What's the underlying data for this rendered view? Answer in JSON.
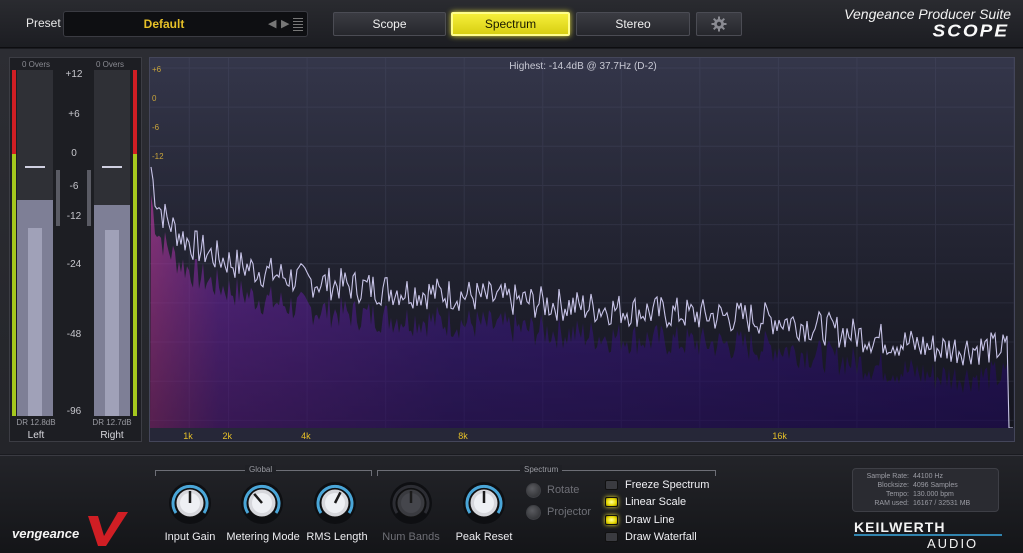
{
  "header": {
    "preset_label": "Preset",
    "preset_name": "Default",
    "preset_prev_icon": "triangle-left-icon",
    "preset_next_icon": "triangle-right-icon",
    "preset_list_icon": "list-icon",
    "tabs": [
      {
        "label": "Scope",
        "active": false
      },
      {
        "label": "Spectrum",
        "active": true
      },
      {
        "label": "Stereo",
        "active": false
      }
    ],
    "settings_icon": "gear-icon",
    "suite_title": "Vengeance Producer Suite",
    "product_logo": "SCOPE"
  },
  "meters": {
    "scale": [
      "+12",
      "+6",
      "0",
      "-6",
      "-12",
      "-24",
      "-48",
      "-96"
    ],
    "channels": [
      {
        "name": "Left",
        "overs": "0 Overs",
        "dr": "DR 12.8dB",
        "level_db": -9.5,
        "rms_db": -16,
        "peak_db": -3
      },
      {
        "name": "Right",
        "overs": "0 Overs",
        "dr": "DR 12.7dB",
        "level_db": -10.5,
        "rms_db": -16.5,
        "peak_db": -3
      }
    ],
    "colors": {
      "red_zone": "#d01e24",
      "green_zone": "#a5c81e"
    }
  },
  "spectrum": {
    "highest_readout": "Highest: -14.4dB @ 37.7Hz (D-2)",
    "db_labels": [
      "+6",
      "0",
      "-6",
      "-12"
    ],
    "freq_labels": [
      "1k",
      "2k",
      "4k",
      "8k",
      "16k"
    ],
    "freq_label_color": "#e6c028",
    "line_color": "#c8c4e8",
    "fill_colors": [
      "#ff4ad8",
      "#3a10a8"
    ],
    "x_scale": "linear",
    "x_range_hz": [
      0,
      22050
    ],
    "chart_data": {
      "type": "area",
      "xlabel": "",
      "ylabel": "",
      "x_ticks": [
        "1k",
        "2k",
        "4k",
        "8k",
        "16k"
      ],
      "y_ticks": [
        "+6",
        "0",
        "-6",
        "-12"
      ],
      "series_description_points": [
        {
          "x": 37.7,
          "y": -14.4
        },
        {
          "x": 500,
          "y": -26
        },
        {
          "x": 2000,
          "y": -34
        },
        {
          "x": 4000,
          "y": -38
        },
        {
          "x": 8000,
          "y": -41
        },
        {
          "x": 12000,
          "y": -44
        },
        {
          "x": 16000,
          "y": -46
        },
        {
          "x": 20000,
          "y": -52
        }
      ]
    }
  },
  "controls": {
    "global_title": "Global",
    "spectrum_title": "Spectrum",
    "knobs": [
      {
        "label": "Input Gain",
        "value": 0.5,
        "enabled": true
      },
      {
        "label": "Metering Mode",
        "value": 0.35,
        "enabled": true
      },
      {
        "label": "RMS Length",
        "value": 0.6,
        "enabled": true
      },
      {
        "label": "Num Bands",
        "value": 0.5,
        "enabled": false
      },
      {
        "label": "Peak Reset",
        "value": 0.5,
        "enabled": true
      }
    ],
    "small_knobs": [
      {
        "label": "Rotate",
        "enabled": false
      },
      {
        "label": "Projector",
        "enabled": false
      }
    ],
    "toggles": [
      {
        "label": "Freeze Spectrum",
        "on": false
      },
      {
        "label": "Linear Scale",
        "on": true
      },
      {
        "label": "Draw Line",
        "on": true
      },
      {
        "label": "Draw Waterfall",
        "on": false
      }
    ],
    "brand_logo": "vengeance",
    "brand_logo_icon": "vengeance-v-logo-icon"
  },
  "info": {
    "rows": [
      {
        "key": "Sample Rate:",
        "value": "44100 Hz"
      },
      {
        "key": "Blocksize:",
        "value": "4096 Samples"
      },
      {
        "key": "Tempo:",
        "value": "130.000 bpm"
      },
      {
        "key": "RAM used:",
        "value": "16167 / 32531 MB"
      }
    ],
    "maker_logo_line1": "KEILWERTH",
    "maker_logo_line2": "AUDIO"
  }
}
